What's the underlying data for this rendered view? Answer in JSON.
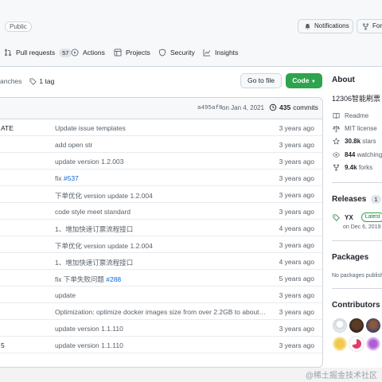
{
  "repo": {
    "visibility": "Public",
    "notifications_label": "Notifications",
    "fork_label": "Fork"
  },
  "tabs": [
    {
      "label": "Pull requests",
      "count": "57",
      "icon": "pull-request-icon"
    },
    {
      "label": "Actions",
      "icon": "play-icon"
    },
    {
      "label": "Projects",
      "icon": "table-icon"
    },
    {
      "label": "Security",
      "icon": "shield-icon"
    },
    {
      "label": "Insights",
      "icon": "graph-icon"
    }
  ],
  "branch_row": {
    "branches_label": "anches",
    "tags_label": "1 tag",
    "goto_file": "Go to file",
    "code": "Code"
  },
  "latest_commit": {
    "hash": "a495af8",
    "date": "on Jan 4, 2021",
    "count": "435",
    "count_label": "commits"
  },
  "files": [
    {
      "name": "ATE",
      "message": "Update issue templates",
      "link": "",
      "age": "3 years ago"
    },
    {
      "name": "",
      "message": "add open str",
      "link": "",
      "age": "3 years ago"
    },
    {
      "name": "",
      "message": "update version 1.2.003",
      "link": "",
      "age": "3 years ago"
    },
    {
      "name": "",
      "message": "fix ",
      "link": "#537",
      "age": "3 years ago"
    },
    {
      "name": "",
      "message": "下单优化 version update 1.2.004",
      "link": "",
      "age": "3 years ago"
    },
    {
      "name": "",
      "message": "code style meet standard",
      "link": "",
      "age": "3 years ago"
    },
    {
      "name": "",
      "message": "1、增加快速订票流程接口",
      "link": "",
      "age": "4 years ago"
    },
    {
      "name": "",
      "message": "下单优化 version update 1.2.004",
      "link": "",
      "age": "3 years ago"
    },
    {
      "name": "",
      "message": "1、增加快速订票流程接口",
      "link": "",
      "age": "4 years ago"
    },
    {
      "name": "",
      "message": "fix 下单失败问题 ",
      "link": "#288",
      "age": "5 years ago"
    },
    {
      "name": "",
      "message": "update",
      "link": "",
      "age": "3 years ago"
    },
    {
      "name": "",
      "message": "Optimization: optimize docker images size from over 2.2GB to about 76...",
      "link": "",
      "age": "3 years ago"
    },
    {
      "name": "",
      "message": "update version 1.1.110",
      "link": "",
      "age": "3 years ago"
    },
    {
      "name": "5",
      "message": "update version 1.1.110",
      "link": "",
      "age": "3 years ago"
    },
    {
      "name": "",
      "message": "",
      "link": "",
      "age": ""
    }
  ],
  "sidebar": {
    "about_title": "About",
    "description": "12306智能刷票",
    "readme": "Readme",
    "license": "MIT license",
    "stars_value": "30.8k",
    "stars_label": "stars",
    "watching_value": "844",
    "watching_label": "watching",
    "forks_value": "9.4k",
    "forks_label": "forks",
    "releases_title": "Releases",
    "releases_count": "1",
    "release_name": "YX",
    "release_badge": "Latest",
    "release_date": "on Dec 6, 2019",
    "packages_title": "Packages",
    "packages_text": "No packages published",
    "contributors_title": "Contributors",
    "contributors_count": "2"
  },
  "watermark": "@稀土掘金技术社区",
  "colors": {
    "accent": "#0969da",
    "code_button": "#2da44e",
    "border": "#d0d7de"
  }
}
